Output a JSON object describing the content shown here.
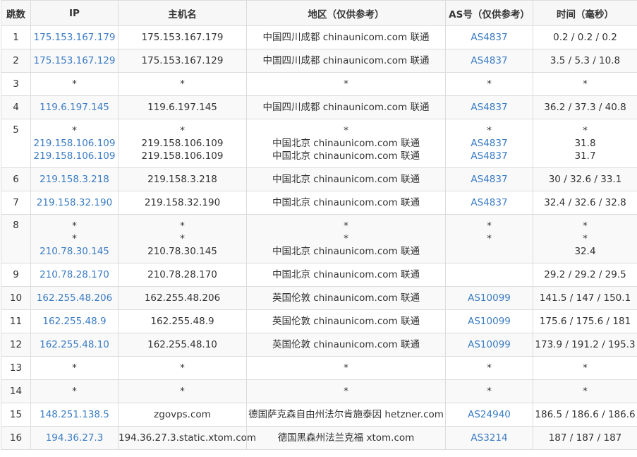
{
  "table": {
    "headers": [
      "跳数",
      "IP",
      "主机名",
      "地区（仅供参考）",
      "AS号（仅供参考）",
      "时间（毫秒）"
    ],
    "rows": [
      {
        "hop": "1",
        "ip": [
          "175.153.167.179"
        ],
        "host": [
          "175.153.167.179"
        ],
        "region": [
          "中国四川成都 chinaunicom.com 联通"
        ],
        "as": [
          "AS4837"
        ],
        "time": [
          "0.2 / 0.2 / 0.2"
        ]
      },
      {
        "hop": "2",
        "ip": [
          "175.153.167.129"
        ],
        "host": [
          "175.153.167.129"
        ],
        "region": [
          "中国四川成都 chinaunicom.com 联通"
        ],
        "as": [
          "AS4837"
        ],
        "time": [
          "3.5 / 5.3 / 10.8"
        ]
      },
      {
        "hop": "3",
        "ip": [
          "*"
        ],
        "host": [
          "*"
        ],
        "region": [
          "*"
        ],
        "as": [
          "*"
        ],
        "time": [
          "*"
        ]
      },
      {
        "hop": "4",
        "ip": [
          "119.6.197.145"
        ],
        "host": [
          "119.6.197.145"
        ],
        "region": [
          "中国四川成都 chinaunicom.com 联通"
        ],
        "as": [
          "AS4837"
        ],
        "time": [
          "36.2 / 37.3 / 40.8"
        ]
      },
      {
        "hop": "5",
        "ip": [
          "*",
          "219.158.106.109",
          "219.158.106.109"
        ],
        "host": [
          "*",
          "219.158.106.109",
          "219.158.106.109"
        ],
        "region": [
          "*",
          "中国北京 chinaunicom.com 联通",
          "中国北京 chinaunicom.com 联通"
        ],
        "as": [
          "*",
          "AS4837",
          "AS4837"
        ],
        "time": [
          "*",
          "31.8",
          "31.7"
        ]
      },
      {
        "hop": "6",
        "ip": [
          "219.158.3.218"
        ],
        "host": [
          "219.158.3.218"
        ],
        "region": [
          "中国北京 chinaunicom.com 联通"
        ],
        "as": [
          "AS4837"
        ],
        "time": [
          "30 / 32.6 / 33.1"
        ]
      },
      {
        "hop": "7",
        "ip": [
          "219.158.32.190"
        ],
        "host": [
          "219.158.32.190"
        ],
        "region": [
          "中国北京 chinaunicom.com 联通"
        ],
        "as": [
          "AS4837"
        ],
        "time": [
          "32.4 / 32.6 / 32.8"
        ]
      },
      {
        "hop": "8",
        "ip": [
          "*",
          "*",
          "210.78.30.145"
        ],
        "host": [
          "*",
          "*",
          "210.78.30.145"
        ],
        "region": [
          "*",
          "*",
          "中国北京 chinaunicom.com 联通"
        ],
        "as": [
          "*",
          "*",
          ""
        ],
        "time": [
          "*",
          "*",
          "32.4"
        ]
      },
      {
        "hop": "9",
        "ip": [
          "210.78.28.170"
        ],
        "host": [
          "210.78.28.170"
        ],
        "region": [
          "中国北京 chinaunicom.com 联通"
        ],
        "as": [
          ""
        ],
        "time": [
          "29.2 / 29.2 / 29.5"
        ]
      },
      {
        "hop": "10",
        "ip": [
          "162.255.48.206"
        ],
        "host": [
          "162.255.48.206"
        ],
        "region": [
          "英国伦敦 chinaunicom.com 联通"
        ],
        "as": [
          "AS10099"
        ],
        "time": [
          "141.5 / 147 / 150.1"
        ]
      },
      {
        "hop": "11",
        "ip": [
          "162.255.48.9"
        ],
        "host": [
          "162.255.48.9"
        ],
        "region": [
          "英国伦敦 chinaunicom.com 联通"
        ],
        "as": [
          "AS10099"
        ],
        "time": [
          "175.6 / 175.6 / 181"
        ]
      },
      {
        "hop": "12",
        "ip": [
          "162.255.48.10"
        ],
        "host": [
          "162.255.48.10"
        ],
        "region": [
          "英国伦敦 chinaunicom.com 联通"
        ],
        "as": [
          "AS10099"
        ],
        "time": [
          "173.9 / 191.2 / 195.3"
        ]
      },
      {
        "hop": "13",
        "ip": [
          "*"
        ],
        "host": [
          "*"
        ],
        "region": [
          "*"
        ],
        "as": [
          "*"
        ],
        "time": [
          "*"
        ]
      },
      {
        "hop": "14",
        "ip": [
          "*"
        ],
        "host": [
          "*"
        ],
        "region": [
          "*"
        ],
        "as": [
          "*"
        ],
        "time": [
          "*"
        ]
      },
      {
        "hop": "15",
        "ip": [
          "148.251.138.5"
        ],
        "host": [
          "zgovps.com"
        ],
        "region": [
          "德国萨克森自由州法尔肯施泰因 hetzner.com"
        ],
        "as": [
          "AS24940"
        ],
        "time": [
          "186.5 / 186.6 / 186.6"
        ]
      },
      {
        "hop": "16",
        "ip": [
          "194.36.27.3"
        ],
        "host": [
          "194.36.27.3.static.xtom.com"
        ],
        "region": [
          "德国黑森州法兰克福 xtom.com"
        ],
        "as": [
          "AS3214"
        ],
        "time": [
          "187 / 187 / 187"
        ]
      }
    ]
  },
  "colors": {
    "link": "#3a7cc4",
    "text": "#333333",
    "border": "#dcdcdc"
  }
}
